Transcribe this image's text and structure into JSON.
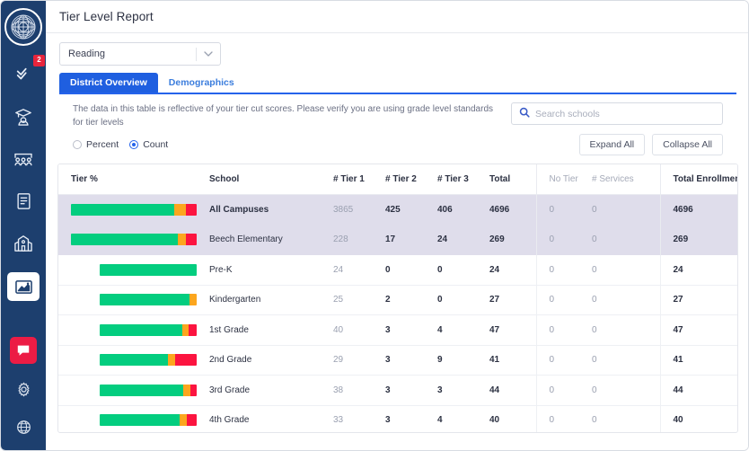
{
  "sidebar": {
    "logo_name": "app-logo",
    "items": [
      {
        "name": "tasks",
        "icon": "check-list-icon",
        "badge": "2",
        "active": false
      },
      {
        "name": "students",
        "icon": "graduation-cap-icon",
        "badge": null,
        "active": false
      },
      {
        "name": "groups",
        "icon": "people-group-icon",
        "badge": null,
        "active": false
      },
      {
        "name": "library",
        "icon": "book-icon",
        "badge": null,
        "active": false
      },
      {
        "name": "schools",
        "icon": "school-building-icon",
        "badge": null,
        "active": false
      },
      {
        "name": "reports",
        "icon": "chart-report-icon",
        "badge": null,
        "active": true
      }
    ],
    "bottom_items": [
      {
        "name": "messages",
        "icon": "chat-bubble-icon"
      },
      {
        "name": "settings",
        "icon": "gear-icon"
      },
      {
        "name": "help",
        "icon": "globe-help-icon"
      }
    ]
  },
  "header": {
    "title": "Tier Level Report"
  },
  "subject_select": {
    "value": "Reading",
    "caret": "chevron-down-icon"
  },
  "tabs": [
    {
      "label": "District Overview",
      "active": true
    },
    {
      "label": "Demographics",
      "active": false
    }
  ],
  "info_text": "The data in this table is reflective of your tier cut scores. Please verify you are using grade level standards for tier levels",
  "search": {
    "placeholder": "Search schools",
    "value": "",
    "icon": "search-icon"
  },
  "display_mode": {
    "options": [
      {
        "label": "Percent",
        "selected": false
      },
      {
        "label": "Count",
        "selected": true
      }
    ]
  },
  "buttons": {
    "expand_all": "Expand All",
    "collapse_all": "Collapse All"
  },
  "table": {
    "columns": [
      {
        "key": "tier_pct",
        "label": "Tier %",
        "muted": false
      },
      {
        "key": "school",
        "label": "School",
        "muted": false
      },
      {
        "key": "tier1",
        "label": "# Tier 1",
        "muted": false
      },
      {
        "key": "tier2",
        "label": "# Tier 2",
        "muted": false
      },
      {
        "key": "tier3",
        "label": "# Tier 3",
        "muted": false
      },
      {
        "key": "total",
        "label": "Total",
        "muted": false
      },
      {
        "key": "no_tier",
        "label": "No Tier",
        "muted": true
      },
      {
        "key": "services",
        "label": "# Services",
        "muted": true
      },
      {
        "key": "enrollment",
        "label": "Total Enrollment",
        "muted": false
      }
    ],
    "rows": [
      {
        "school": "All Campuses",
        "bold": true,
        "highlight": true,
        "indent": false,
        "bar": [
          82.3,
          9.1,
          8.6
        ],
        "tier1": "3865",
        "tier2": "425",
        "tier3": "406",
        "total": "4696",
        "no_tier": "0",
        "services": "0",
        "enrollment": "4696"
      },
      {
        "school": "Beech Elementary",
        "bold": false,
        "highlight": true,
        "indent": false,
        "bar": [
          84.8,
          6.3,
          8.9
        ],
        "tier1": "228",
        "tier2": "17",
        "tier3": "24",
        "total": "269",
        "no_tier": "0",
        "services": "0",
        "enrollment": "269"
      },
      {
        "school": "Pre-K",
        "bold": false,
        "highlight": false,
        "indent": true,
        "bar": [
          100,
          0,
          0
        ],
        "tier1": "24",
        "tier2": "0",
        "tier3": "0",
        "total": "24",
        "no_tier": "0",
        "services": "0",
        "enrollment": "24"
      },
      {
        "school": "Kindergarten",
        "bold": false,
        "highlight": false,
        "indent": true,
        "bar": [
          92.6,
          7.4,
          0
        ],
        "tier1": "25",
        "tier2": "2",
        "tier3": "0",
        "total": "27",
        "no_tier": "0",
        "services": "0",
        "enrollment": "27"
      },
      {
        "school": "1st Grade",
        "bold": false,
        "highlight": false,
        "indent": true,
        "bar": [
          85.1,
          6.4,
          8.5
        ],
        "tier1": "40",
        "tier2": "3",
        "tier3": "4",
        "total": "47",
        "no_tier": "0",
        "services": "0",
        "enrollment": "47"
      },
      {
        "school": "2nd Grade",
        "bold": false,
        "highlight": false,
        "indent": true,
        "bar": [
          70.7,
          7.3,
          22.0
        ],
        "tier1": "29",
        "tier2": "3",
        "tier3": "9",
        "total": "41",
        "no_tier": "0",
        "services": "0",
        "enrollment": "41"
      },
      {
        "school": "3rd Grade",
        "bold": false,
        "highlight": false,
        "indent": true,
        "bar": [
          86.4,
          6.8,
          6.8
        ],
        "tier1": "38",
        "tier2": "3",
        "tier3": "3",
        "total": "44",
        "no_tier": "0",
        "services": "0",
        "enrollment": "44"
      },
      {
        "school": "4th Grade",
        "bold": false,
        "highlight": false,
        "indent": true,
        "bar": [
          82.5,
          7.5,
          10.0
        ],
        "tier1": "33",
        "tier2": "3",
        "tier3": "4",
        "total": "40",
        "no_tier": "0",
        "services": "0",
        "enrollment": "40"
      }
    ]
  },
  "colors": {
    "tier1": "#03cd7f",
    "tier2": "#fca61e",
    "tier3": "#fc1440",
    "accent": "#1f5fe0",
    "sidebar": "#1d3f6e",
    "badge": "#e8253c",
    "highlight_row": "#dfddeb"
  }
}
